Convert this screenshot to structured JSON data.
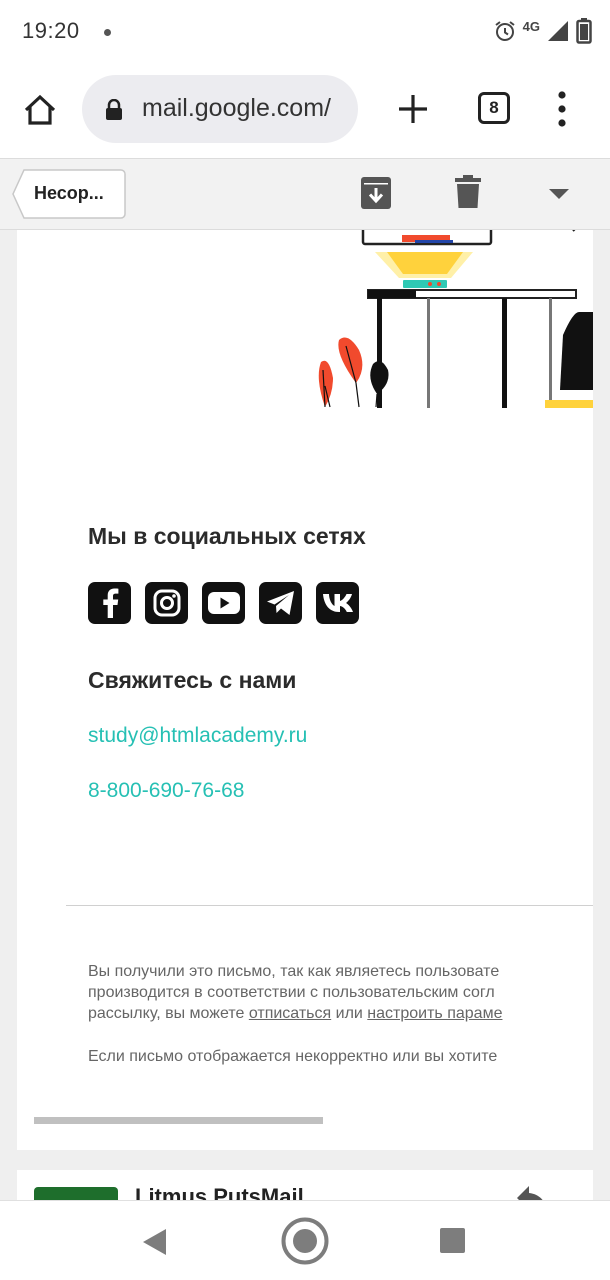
{
  "status_bar": {
    "time": "19:20",
    "network": "4G"
  },
  "browser": {
    "url": "mail.google.com/",
    "tab_count": "8"
  },
  "gmail_toolbar": {
    "back_label": "Несор..."
  },
  "email": {
    "social_heading": "Мы в социальных сетях",
    "social_icons": [
      "facebook-icon",
      "instagram-icon",
      "youtube-icon",
      "telegram-icon",
      "vk-icon"
    ],
    "contact_heading": "Свяжитесь с нами",
    "email": "study@htmlacademy.ru",
    "phone": "8-800-690-76-68",
    "footer_line1": "Вы получили это письмо, так как являетесь пользовате",
    "footer_line2": "производится в соответствии с пользовательским согл",
    "footer_line3_before": "рассылку, вы можете ",
    "footer_unsubscribe": "отписаться",
    "footer_or": " или ",
    "footer_settings": "настроить параме",
    "footer_note": "Если письмо отображается некорректно или вы хотите"
  },
  "next_email": {
    "sender": "Litmus PutsMail"
  },
  "colors": {
    "link": "#26c0b4",
    "heading": "#2b2b2b",
    "avatar": "#1e6e2c"
  }
}
